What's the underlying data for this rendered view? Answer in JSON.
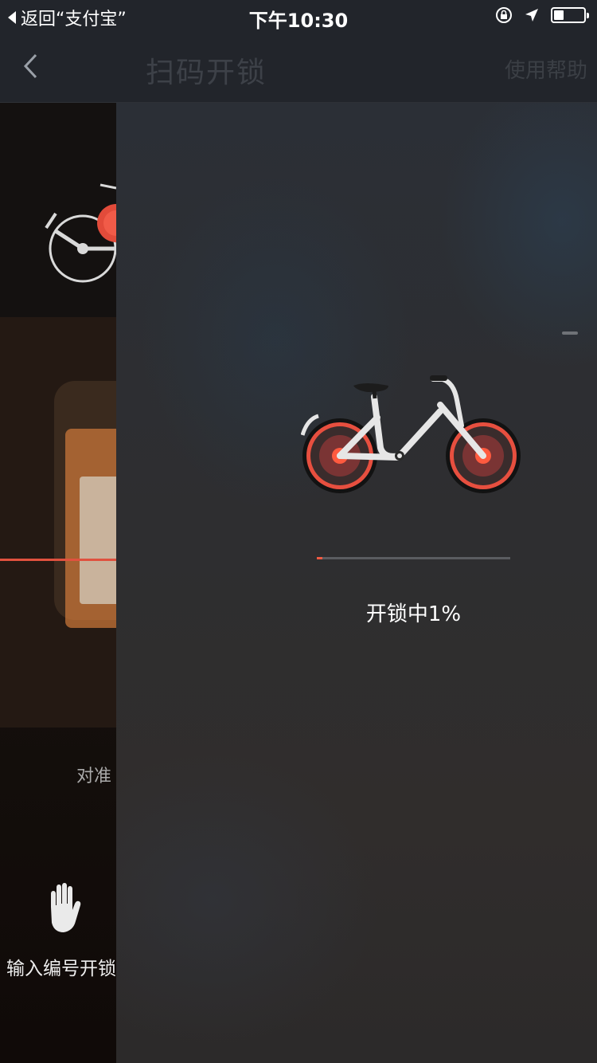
{
  "status_bar": {
    "back_app": "返回“支付宝”",
    "time": "下午10:30",
    "battery_level": 0.3
  },
  "navbar": {
    "title": "扫码开锁",
    "help": "使用帮助"
  },
  "scan_page": {
    "hint": "对准",
    "manual_unlock_label": "输入编号开锁"
  },
  "unlock": {
    "progress": 0.01,
    "status_label": "开锁中1%"
  },
  "colors": {
    "accent": "#f05a43",
    "wheel_rim": "#e74f3f",
    "panel_bg": "#2e3036"
  }
}
